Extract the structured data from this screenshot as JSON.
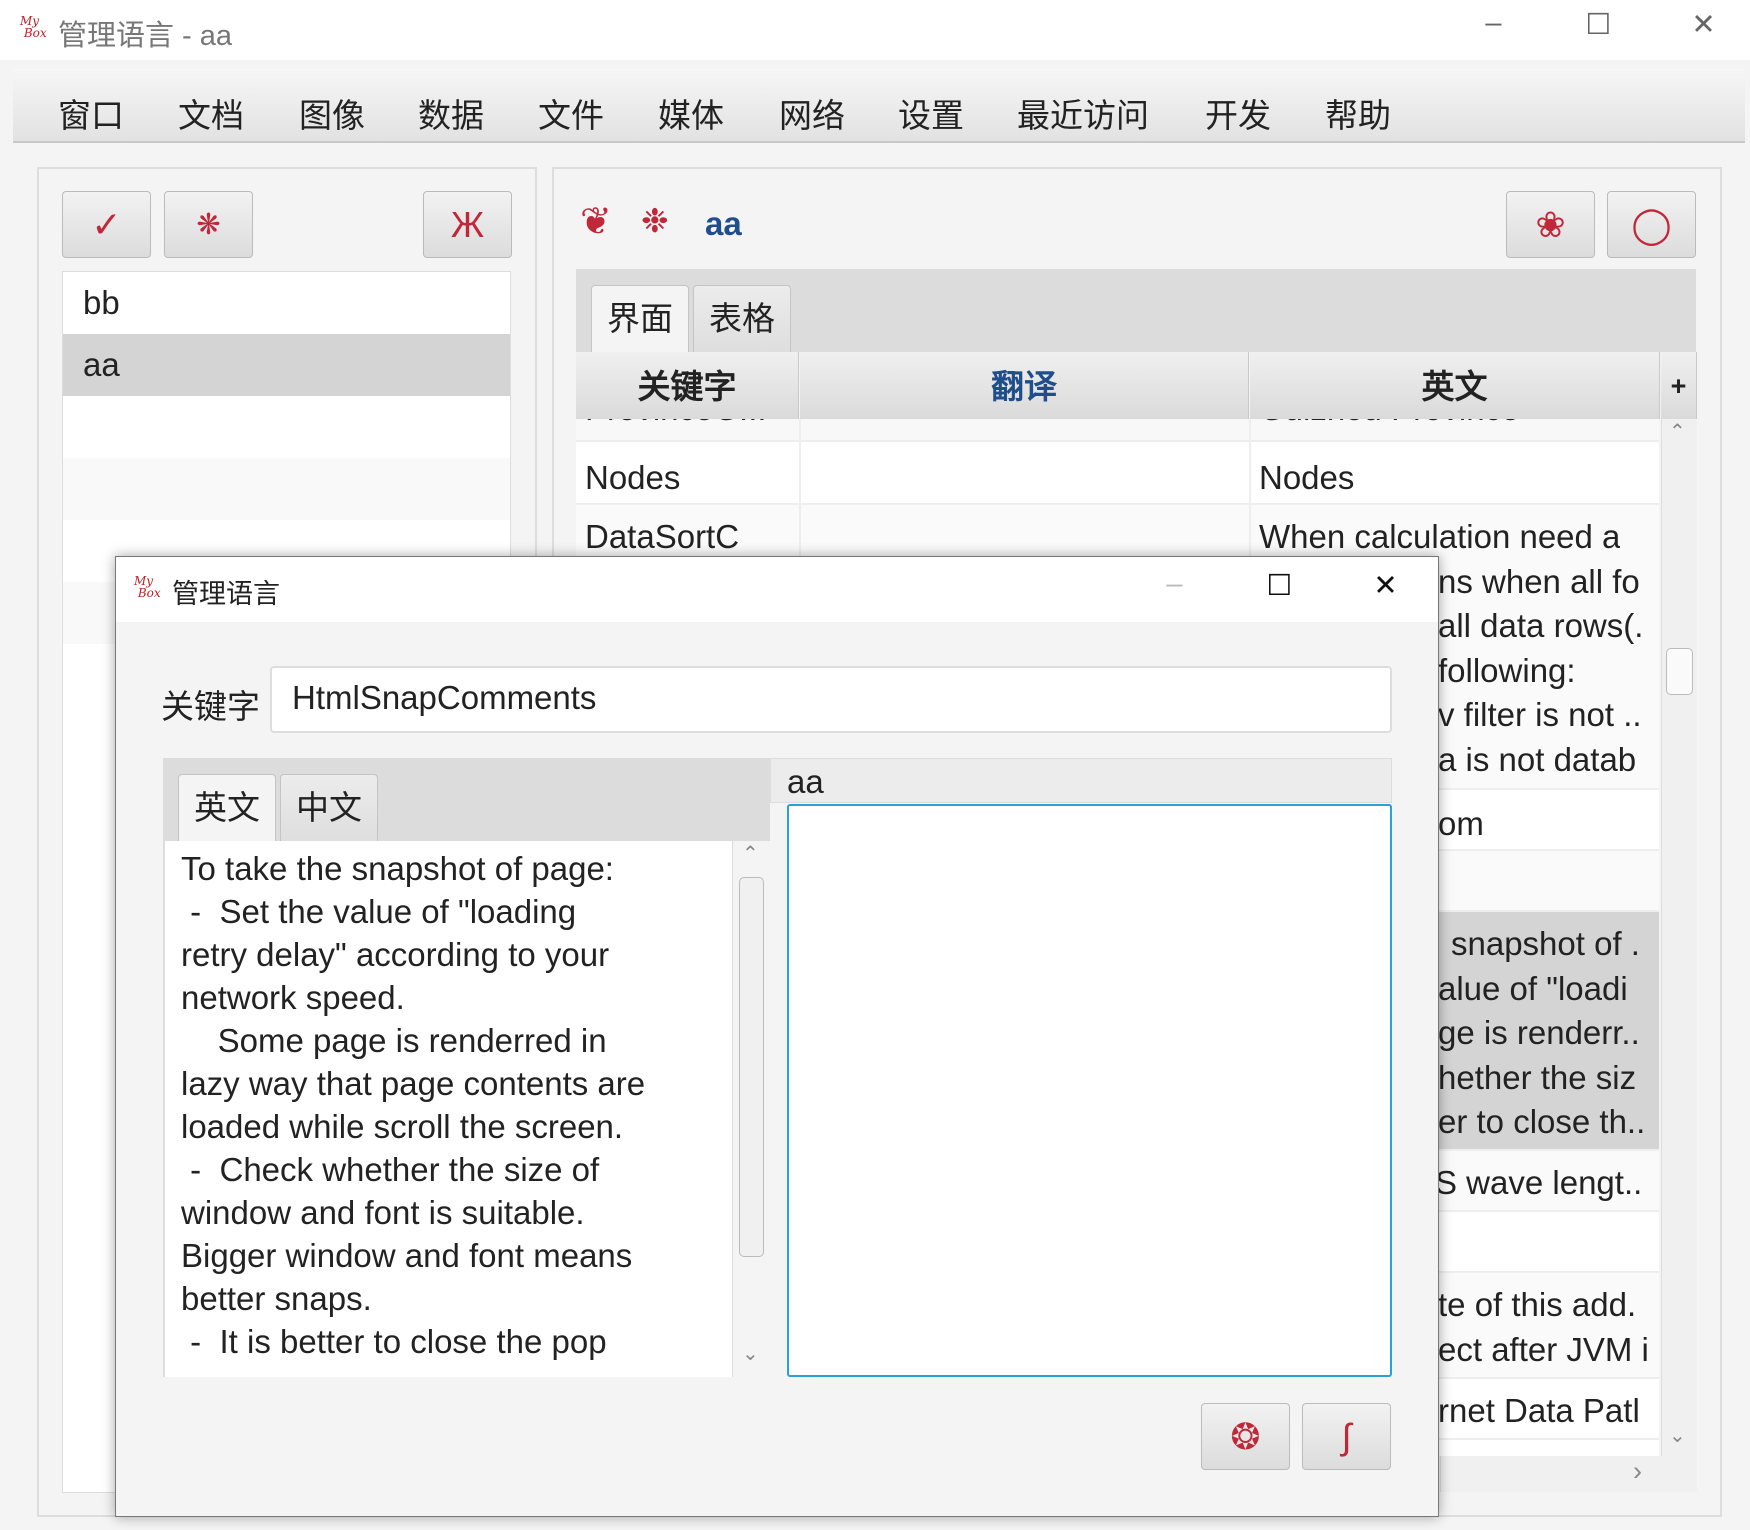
{
  "window": {
    "title": "管理语言 - aa",
    "logo": "MyBox"
  },
  "menu": [
    "窗口",
    "文档",
    "图像",
    "数据",
    "文件",
    "媒体",
    "网络",
    "设置",
    "最近访问",
    "开发",
    "帮助"
  ],
  "languages": [
    "bb",
    "aa"
  ],
  "selected_language": "aa",
  "right_header": {
    "title": "aa"
  },
  "tabs": [
    "界面",
    "表格"
  ],
  "table": {
    "columns": [
      "关键字",
      "翻译",
      "英文"
    ],
    "add_column": "+",
    "rows": [
      {
        "key": "ProvinceG...",
        "translation": "",
        "english": [
          "Guizhou Province"
        ]
      },
      {
        "key": "Nodes",
        "translation": "",
        "english": [
          "Nodes"
        ]
      },
      {
        "key": "DataSortC",
        "translation": "",
        "english": [
          "When calculation need a",
          "ns when all fo",
          "all data rows(.",
          "following:",
          "v filter is not ..",
          "a is not datab"
        ]
      },
      {
        "key": "",
        "translation": "",
        "english": [
          "om"
        ]
      },
      {
        "key": "",
        "translation": "",
        "english": []
      },
      {
        "key": "",
        "translation": "",
        "english": [
          "snapshot of .",
          "alue of \"loadi",
          "ge is renderr..",
          "hether the siz",
          "er to close th.."
        ]
      },
      {
        "key": "",
        "translation": "",
        "english": [
          "S wave lengt.."
        ]
      },
      {
        "key": "",
        "translation": "",
        "english": []
      },
      {
        "key": "",
        "translation": "",
        "english": [
          "te of this add.",
          "ect after JVM i"
        ]
      },
      {
        "key": "",
        "translation": "",
        "english": [
          "rnet Data Patl"
        ]
      }
    ]
  },
  "dialog": {
    "title": "管理语言",
    "key_label": "关键字",
    "key_value": "HtmlSnapComments",
    "tabs": [
      "英文",
      "中文"
    ],
    "english_text": [
      "To take the snapshot of page:",
      " -  Set the value of \"loading",
      "retry delay\" according to your",
      "network speed.",
      "    Some page is renderred in",
      "lazy way that page contents are",
      "loaded while scroll the screen.",
      " -  Check whether the size of",
      "window and font is suitable.",
      "Bigger window and font means",
      "better snaps.",
      " -  It is better to close the pop"
    ],
    "translation_label": "aa",
    "translation_value": ""
  },
  "colors": {
    "accent": "#c0283a",
    "header_blue": "#1f4e8c",
    "focus": "#2aa0d8"
  }
}
